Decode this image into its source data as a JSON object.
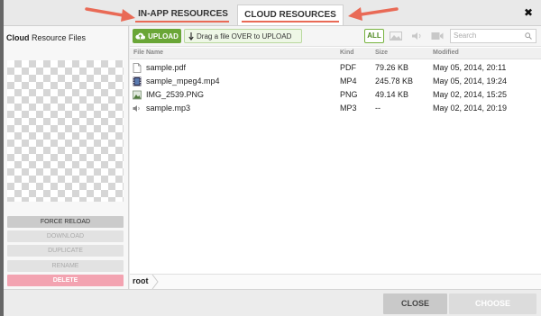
{
  "tabs": {
    "in_app": "IN-APP RESOURCES",
    "cloud": "CLOUD RESOURCES",
    "active": "cloud",
    "underline_color": "#e96a56",
    "arrow_color": "#e96a56"
  },
  "close_glyph": "✖",
  "left_panel": {
    "title_bold": "Cloud",
    "title_rest": " Resource Files",
    "buttons": {
      "force_reload": "FORCE RELOAD",
      "download": "DOWNLOAD",
      "duplicate": "DUPLICATE",
      "rename": "RENAME",
      "delete": "DELETE"
    },
    "delete_color": "#f3a3b1"
  },
  "toolbar": {
    "upload_label": "UPLOAD",
    "dropzone_label": "Drag a file OVER to UPLOAD",
    "filter_all_label": "ALL",
    "filter_icons": [
      "image-icon",
      "audio-icon",
      "video-icon"
    ],
    "search_placeholder": "Search",
    "upload_color": "#6aa637"
  },
  "table": {
    "columns": [
      "File Name",
      "Kind",
      "Size",
      "Modified"
    ],
    "rows": [
      {
        "name": "sample.pdf",
        "kind": "PDF",
        "size": "79.26 KB",
        "modified": "May 05, 2014, 20:11",
        "icon": "document-icon"
      },
      {
        "name": "sample_mpeg4.mp4",
        "kind": "MP4",
        "size": "245.78 KB",
        "modified": "May 05, 2014, 19:24",
        "icon": "film-icon"
      },
      {
        "name": "IMG_2539.PNG",
        "kind": "PNG",
        "size": "49.14 KB",
        "modified": "May 02, 2014, 15:25",
        "icon": "image-icon"
      },
      {
        "name": "sample.mp3",
        "kind": "MP3",
        "size": "--",
        "modified": "May 02, 2014, 20:19",
        "icon": "speaker-icon"
      }
    ]
  },
  "breadcrumb": {
    "root": "root"
  },
  "footer": {
    "close": "CLOSE",
    "choose": "CHOOSE"
  }
}
